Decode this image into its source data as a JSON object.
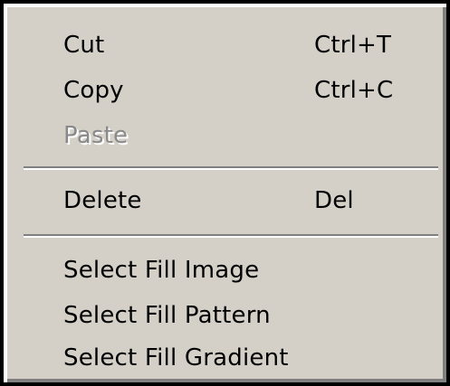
{
  "context_menu": {
    "groups": [
      {
        "items": [
          {
            "label": "Cut",
            "shortcut": "Ctrl+T",
            "enabled": true
          },
          {
            "label": "Copy",
            "shortcut": "Ctrl+C",
            "enabled": true
          },
          {
            "label": "Paste",
            "shortcut": "",
            "enabled": false
          }
        ]
      },
      {
        "items": [
          {
            "label": "Delete",
            "shortcut": "Del",
            "enabled": true
          }
        ]
      },
      {
        "items": [
          {
            "label": "Select Fill Image",
            "shortcut": "",
            "enabled": true
          },
          {
            "label": "Select Fill Pattern",
            "shortcut": "",
            "enabled": true
          },
          {
            "label": "Select Fill Gradient",
            "shortcut": "",
            "enabled": true
          }
        ]
      }
    ],
    "colors": {
      "background": "#d4d0c8",
      "text": "#000000",
      "disabled_text": "#8a8a8a",
      "frame": "#000000"
    }
  }
}
